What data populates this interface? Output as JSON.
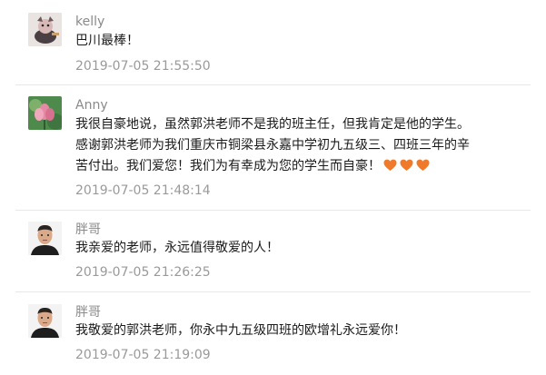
{
  "comments": [
    {
      "author": "kelly",
      "lines": [
        "巴川最棒！"
      ],
      "time": "2019-07-05 21:55:50",
      "hearts": 0,
      "avatar_icon": "cartoon-figure-avatar"
    },
    {
      "author": "Anny",
      "lines": [
        "我很自豪地说，虽然郭洪老师不是我的班主任，但我肯定是他的学生。",
        "感谢郭洪老师为我们重庆市铜梁县永嘉中学初九五级三、四班三年的辛",
        "苦付出。我们爱您！我们为有幸成为您的学生而自豪！"
      ],
      "time": "2019-07-05 21:48:14",
      "hearts": 3,
      "heart_color": "#f07a2b",
      "avatar_icon": "lotus-flower-avatar"
    },
    {
      "author": "胖哥",
      "lines": [
        "我亲爱的老师，永远值得敬爱的人！"
      ],
      "time": "2019-07-05 21:26:25",
      "hearts": 0,
      "avatar_icon": "man-portrait-avatar"
    },
    {
      "author": "胖哥",
      "lines": [
        "我敬爱的郭洪老师，你永中九五级四班的欧增礼永远爱你！"
      ],
      "time": "2019-07-05 21:19:09",
      "hearts": 0,
      "avatar_icon": "man-portrait-avatar"
    }
  ]
}
